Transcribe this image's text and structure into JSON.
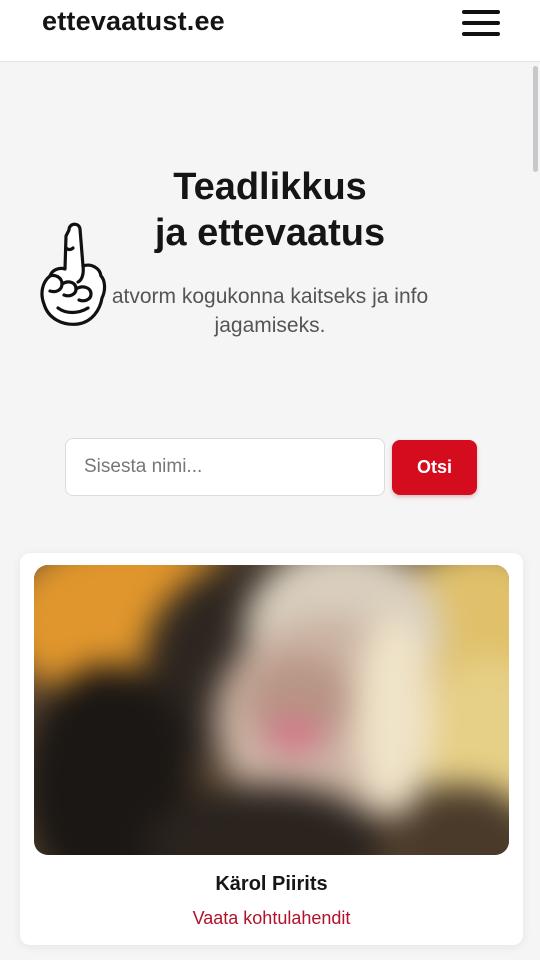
{
  "header": {
    "logo": "ettevaatust.ee",
    "menu_icon": "hamburger-menu-icon"
  },
  "hero": {
    "title_line1": "Teadlikkus",
    "title_line2": "ja ettevaatus",
    "subtitle_line1": "atvorm kogukonna kaitseks ja info",
    "subtitle_line2": "jagamiseks.",
    "overlay_icon": "raised-middle-finger-hand-icon"
  },
  "search": {
    "placeholder": "Sisesta nimi...",
    "value": "",
    "button_label": "Otsi"
  },
  "card": {
    "photo_icon": "blurred-profile-photo",
    "name": "Kärol Piirits",
    "link_label": "Vaata kohtulahendit"
  },
  "colors": {
    "accent": "#d40c1d",
    "link": "#b0122a",
    "background": "#f5f5f6"
  }
}
